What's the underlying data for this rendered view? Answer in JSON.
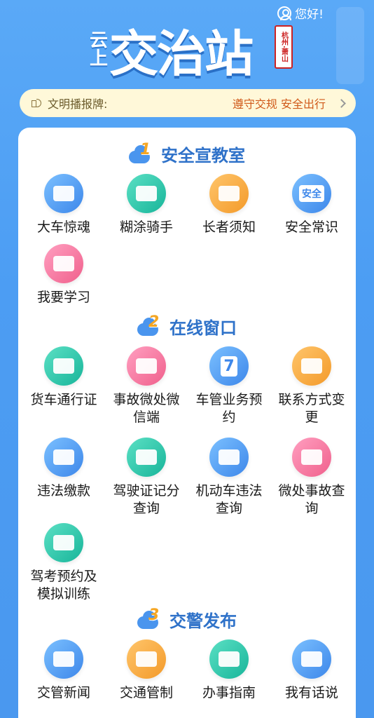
{
  "header": {
    "greeting": "您好!"
  },
  "logo": {
    "small_top": "云",
    "small_bottom": "上",
    "main": "交治站",
    "seal": "杭州·萧山"
  },
  "ticker": {
    "label": "文明播报牌:",
    "message": "遵守交规 安全出行"
  },
  "sections": [
    {
      "number": "1",
      "title": "安全宣教室",
      "items": [
        {
          "label": "大车惊魂",
          "icon": "truck-icon",
          "color": "blue"
        },
        {
          "label": "糊涂骑手",
          "icon": "scooter-icon",
          "color": "teal"
        },
        {
          "label": "长者须知",
          "icon": "elder-icon",
          "color": "orange"
        },
        {
          "label": "安全常识",
          "icon": "safety-book-icon",
          "color": "blue",
          "badge": "安全"
        },
        {
          "label": "我要学习",
          "icon": "video-icon",
          "color": "pink"
        }
      ]
    },
    {
      "number": "2",
      "title": "在线窗口",
      "items": [
        {
          "label": "货车通行证",
          "icon": "truck-pass-icon",
          "color": "teal"
        },
        {
          "label": "事故微处微信端",
          "icon": "accident-icon",
          "color": "pink"
        },
        {
          "label": "车管业务预约",
          "icon": "calendar-icon",
          "color": "blue",
          "badge": "7"
        },
        {
          "label": "联系方式变更",
          "icon": "phone-icon",
          "color": "orange"
        },
        {
          "label": "违法缴款",
          "icon": "wallet-icon",
          "color": "blue"
        },
        {
          "label": "驾驶证记分查询",
          "icon": "license-icon",
          "color": "teal"
        },
        {
          "label": "机动车违法查询",
          "icon": "car-search-icon",
          "color": "blue"
        },
        {
          "label": "微处事故查询",
          "icon": "accident-search-icon",
          "color": "pink"
        },
        {
          "label": "驾考预约及模拟训练",
          "icon": "exam-icon",
          "color": "teal"
        }
      ]
    },
    {
      "number": "3",
      "title": "交警发布",
      "items": [
        {
          "label": "交管新闻",
          "icon": "news-icon",
          "color": "blue"
        },
        {
          "label": "交通管制",
          "icon": "traffic-control-icon",
          "color": "orange"
        },
        {
          "label": "办事指南",
          "icon": "guide-book-icon",
          "color": "teal"
        },
        {
          "label": "我有话说",
          "icon": "chat-icon",
          "color": "blue"
        }
      ]
    }
  ]
}
